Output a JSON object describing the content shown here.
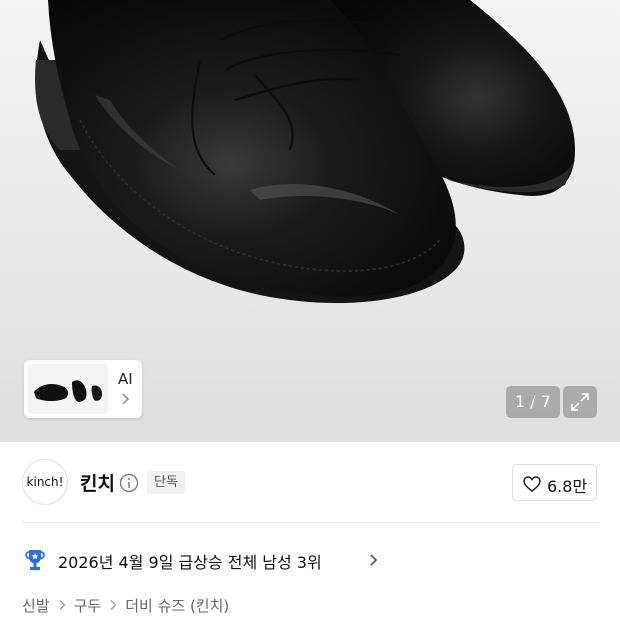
{
  "gallery": {
    "ai_label": "AI",
    "counter": "1 / 7",
    "image_subject": "black-leather-derby-shoes"
  },
  "brand": {
    "logo_text": "kinch!",
    "name": "킨치",
    "exclusive_badge": "단독",
    "like_count": "6.8만"
  },
  "ranking": {
    "text": "2026년 4월 9일 급상승 전체 남성 3위",
    "icon": "trophy-icon",
    "icon_color": "#2f6fdc"
  },
  "breadcrumb": {
    "items": [
      "신발",
      "구두",
      "더비 슈즈 (킨치)"
    ]
  },
  "colors": {
    "text_primary": "#111111",
    "text_secondary": "#666666",
    "badge_bg": "#f1f1f1"
  }
}
